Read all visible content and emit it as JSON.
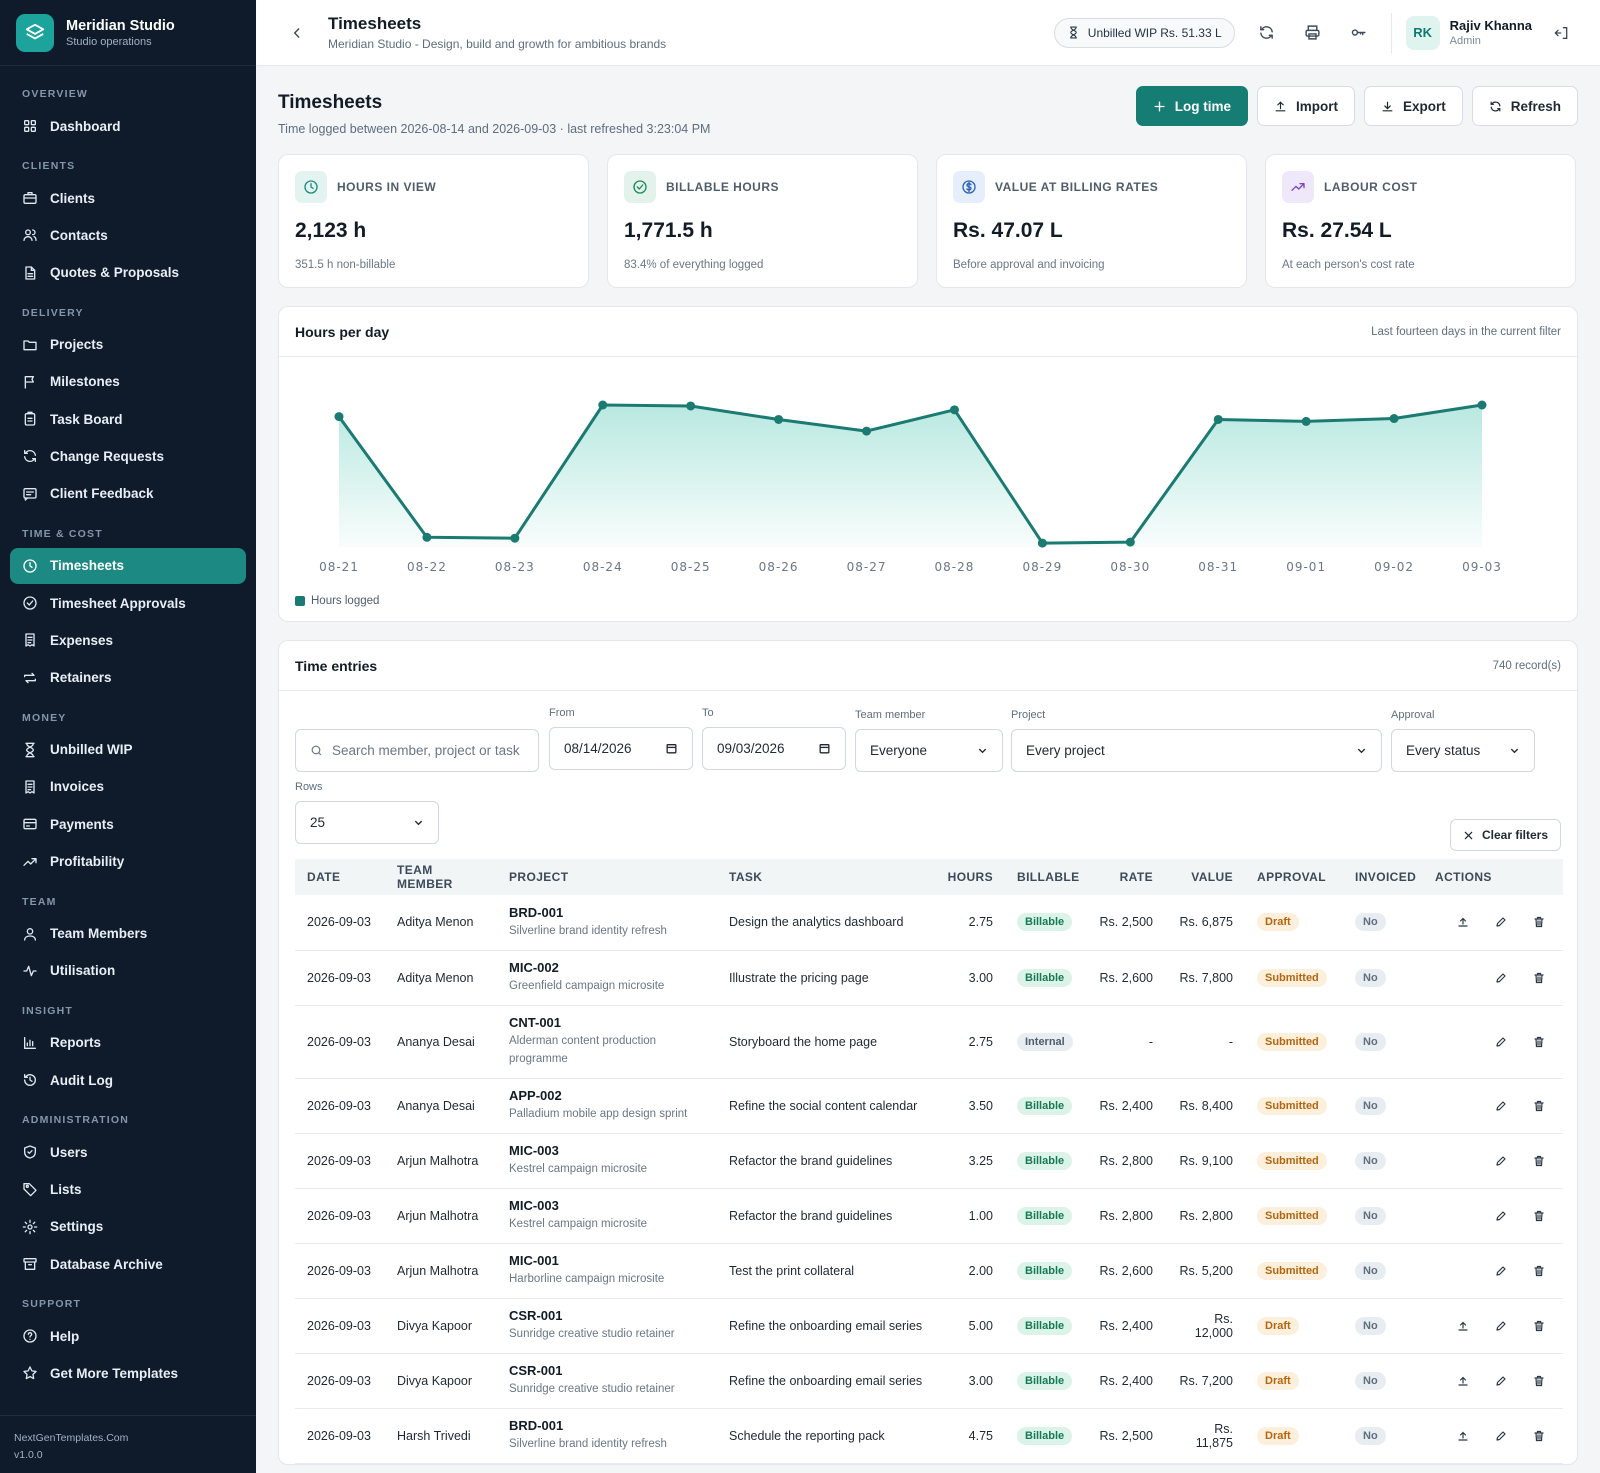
{
  "brand": {
    "name": "Meridian Studio",
    "subtitle": "Studio operations"
  },
  "sidebar": {
    "sections": [
      {
        "title": "OVERVIEW",
        "items": [
          {
            "label": "Dashboard",
            "icon": "grid-icon"
          }
        ]
      },
      {
        "title": "CLIENTS",
        "items": [
          {
            "label": "Clients",
            "icon": "briefcase-icon"
          },
          {
            "label": "Contacts",
            "icon": "users-icon"
          },
          {
            "label": "Quotes & Proposals",
            "icon": "file-icon"
          }
        ]
      },
      {
        "title": "DELIVERY",
        "items": [
          {
            "label": "Projects",
            "icon": "folder-icon"
          },
          {
            "label": "Milestones",
            "icon": "flag-icon"
          },
          {
            "label": "Task Board",
            "icon": "clipboard-icon"
          },
          {
            "label": "Change Requests",
            "icon": "refresh-icon"
          },
          {
            "label": "Client Feedback",
            "icon": "message-icon"
          }
        ]
      },
      {
        "title": "TIME & COST",
        "items": [
          {
            "label": "Timesheets",
            "icon": "clock-icon",
            "active": true
          },
          {
            "label": "Timesheet Approvals",
            "icon": "check-circle-icon"
          },
          {
            "label": "Expenses",
            "icon": "receipt-icon"
          },
          {
            "label": "Retainers",
            "icon": "repeat-icon"
          }
        ]
      },
      {
        "title": "MONEY",
        "items": [
          {
            "label": "Unbilled WIP",
            "icon": "hourglass-icon"
          },
          {
            "label": "Invoices",
            "icon": "receipt-icon"
          },
          {
            "label": "Payments",
            "icon": "card-icon"
          },
          {
            "label": "Profitability",
            "icon": "trend-icon"
          }
        ]
      },
      {
        "title": "TEAM",
        "items": [
          {
            "label": "Team Members",
            "icon": "user-icon"
          },
          {
            "label": "Utilisation",
            "icon": "activity-icon"
          }
        ]
      },
      {
        "title": "INSIGHT",
        "items": [
          {
            "label": "Reports",
            "icon": "bar-chart-icon"
          },
          {
            "label": "Audit Log",
            "icon": "history-icon"
          }
        ]
      },
      {
        "title": "ADMINISTRATION",
        "items": [
          {
            "label": "Users",
            "icon": "shield-icon"
          },
          {
            "label": "Lists",
            "icon": "tag-icon"
          },
          {
            "label": "Settings",
            "icon": "gear-icon"
          },
          {
            "label": "Database Archive",
            "icon": "archive-icon"
          }
        ]
      },
      {
        "title": "SUPPORT",
        "items": [
          {
            "label": "Help",
            "icon": "help-icon"
          },
          {
            "label": "Get More Templates",
            "icon": "star-icon"
          }
        ]
      }
    ],
    "footer": {
      "site": "NextGenTemplates.Com",
      "version": "v1.0.0"
    }
  },
  "topbar": {
    "title": "Timesheets",
    "subtitle": "Meridian Studio - Design, build and growth for ambitious brands",
    "wip": "Unbilled WIP Rs. 51.33 L",
    "user": {
      "initials": "RK",
      "name": "Rajiv Khanna",
      "role": "Admin"
    }
  },
  "page": {
    "title": "Timesheets",
    "subtitle": "Time logged between 2026-08-14 and 2026-09-03 · last refreshed 3:23:04 PM",
    "buttons": {
      "log": "Log time",
      "import": "Import",
      "export": "Export",
      "refresh": "Refresh"
    }
  },
  "stats": [
    {
      "label": "HOURS IN VIEW",
      "value": "2,123 h",
      "note": "351.5 h non-billable",
      "icon": "clock-icon",
      "tint": "#e3f3f0",
      "color": "#1c8a82"
    },
    {
      "label": "BILLABLE HOURS",
      "value": "1,771.5 h",
      "note": "83.4% of everything logged",
      "icon": "check-circle-icon",
      "tint": "#e3f3ec",
      "color": "#1b8a5c"
    },
    {
      "label": "VALUE AT BILLING RATES",
      "value": "Rs. 47.07 L",
      "note": "Before approval and invoicing",
      "icon": "dollar-icon",
      "tint": "#e5eefa",
      "color": "#2a63b5"
    },
    {
      "label": "LABOUR COST",
      "value": "Rs. 27.54 L",
      "note": "At each person's cost rate",
      "icon": "trend-icon",
      "tint": "#efe8fa",
      "color": "#7a45c2"
    }
  ],
  "chart_card": {
    "title": "Hours per day",
    "meta": "Last fourteen days in the current filter"
  },
  "chart_data": {
    "type": "area",
    "categories": [
      "08-21",
      "08-22",
      "08-23",
      "08-24",
      "08-25",
      "08-26",
      "08-27",
      "08-28",
      "08-29",
      "08-30",
      "08-31",
      "09-01",
      "09-02",
      "09-03"
    ],
    "series": [
      {
        "name": "Hours logged",
        "values": [
          128,
          3,
          2,
          140,
          139,
          125,
          113,
          135,
          -3,
          -2,
          125,
          123,
          126,
          140
        ]
      }
    ],
    "ylim": [
      -5,
      140
    ],
    "grid": false,
    "legend": "bottom-left",
    "color": "#1b7a72"
  },
  "entries": {
    "title": "Time entries",
    "count": "740 record(s)",
    "filters": {
      "search_placeholder": "Search member, project or task",
      "from_label": "From",
      "from": "08/14/2026",
      "to_label": "To",
      "to": "09/03/2026",
      "member_label": "Team member",
      "member": "Everyone",
      "project_label": "Project",
      "project": "Every project",
      "approval_label": "Approval",
      "approval": "Every status",
      "rows_label": "Rows",
      "rows": "25",
      "clear": "Clear filters"
    },
    "columns": [
      "DATE",
      "TEAM MEMBER",
      "PROJECT",
      "TASK",
      "HOURS",
      "BILLABLE",
      "RATE",
      "VALUE",
      "APPROVAL",
      "INVOICED",
      "ACTIONS"
    ],
    "rows": [
      {
        "date": "2026-09-03",
        "member": "Aditya Menon",
        "code": "BRD-001",
        "project": "Silverline brand identity refresh",
        "task": "Design the analytics dashboard",
        "hours": "2.75",
        "billable": "Billable",
        "rate": "Rs. 2,500",
        "value": "Rs. 6,875",
        "approval": "Draft",
        "invoiced": "No",
        "submit": true
      },
      {
        "date": "2026-09-03",
        "member": "Aditya Menon",
        "code": "MIC-002",
        "project": "Greenfield campaign microsite",
        "task": "Illustrate the pricing page",
        "hours": "3.00",
        "billable": "Billable",
        "rate": "Rs. 2,600",
        "value": "Rs. 7,800",
        "approval": "Submitted",
        "invoiced": "No",
        "submit": false
      },
      {
        "date": "2026-09-03",
        "member": "Ananya Desai",
        "code": "CNT-001",
        "project": "Alderman content production programme",
        "task": "Storyboard the home page",
        "hours": "2.75",
        "billable": "Internal",
        "rate": "-",
        "value": "-",
        "approval": "Submitted",
        "invoiced": "No",
        "submit": false,
        "tall": true
      },
      {
        "date": "2026-09-03",
        "member": "Ananya Desai",
        "code": "APP-002",
        "project": "Palladium mobile app design sprint",
        "task": "Refine the social content calendar",
        "hours": "3.50",
        "billable": "Billable",
        "rate": "Rs. 2,400",
        "value": "Rs. 8,400",
        "approval": "Submitted",
        "invoiced": "No",
        "submit": false
      },
      {
        "date": "2026-09-03",
        "member": "Arjun Malhotra",
        "code": "MIC-003",
        "project": "Kestrel campaign microsite",
        "task": "Refactor the brand guidelines",
        "hours": "3.25",
        "billable": "Billable",
        "rate": "Rs. 2,800",
        "value": "Rs. 9,100",
        "approval": "Submitted",
        "invoiced": "No",
        "submit": false
      },
      {
        "date": "2026-09-03",
        "member": "Arjun Malhotra",
        "code": "MIC-003",
        "project": "Kestrel campaign microsite",
        "task": "Refactor the brand guidelines",
        "hours": "1.00",
        "billable": "Billable",
        "rate": "Rs. 2,800",
        "value": "Rs. 2,800",
        "approval": "Submitted",
        "invoiced": "No",
        "submit": false
      },
      {
        "date": "2026-09-03",
        "member": "Arjun Malhotra",
        "code": "MIC-001",
        "project": "Harborline campaign microsite",
        "task": "Test the print collateral",
        "hours": "2.00",
        "billable": "Billable",
        "rate": "Rs. 2,600",
        "value": "Rs. 5,200",
        "approval": "Submitted",
        "invoiced": "No",
        "submit": false
      },
      {
        "date": "2026-09-03",
        "member": "Divya Kapoor",
        "code": "CSR-001",
        "project": "Sunridge creative studio retainer",
        "task": "Refine the onboarding email series",
        "hours": "5.00",
        "billable": "Billable",
        "rate": "Rs. 2,400",
        "value": "Rs. 12,000",
        "approval": "Draft",
        "invoiced": "No",
        "submit": true
      },
      {
        "date": "2026-09-03",
        "member": "Divya Kapoor",
        "code": "CSR-001",
        "project": "Sunridge creative studio retainer",
        "task": "Refine the onboarding email series",
        "hours": "3.00",
        "billable": "Billable",
        "rate": "Rs. 2,400",
        "value": "Rs. 7,200",
        "approval": "Draft",
        "invoiced": "No",
        "submit": true
      },
      {
        "date": "2026-09-03",
        "member": "Harsh Trivedi",
        "code": "BRD-001",
        "project": "Silverline brand identity refresh",
        "task": "Schedule the reporting pack",
        "hours": "4.75",
        "billable": "Billable",
        "rate": "Rs. 2,500",
        "value": "Rs. 11,875",
        "approval": "Draft",
        "invoiced": "No",
        "submit": true
      }
    ]
  }
}
